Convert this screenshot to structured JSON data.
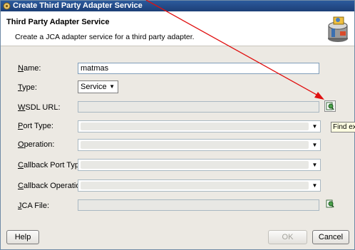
{
  "window": {
    "title": "Create Third Party Adapter Service"
  },
  "banner": {
    "title": "Third Party Adapter Service",
    "description": "Create a JCA adapter service for a third party adapter."
  },
  "form": {
    "name": {
      "label_key": "N",
      "label_rest": "ame:",
      "value": "matmas"
    },
    "type": {
      "label_key": "T",
      "label_rest": "ype:",
      "value": "Service"
    },
    "wsdl_url": {
      "label_key": "W",
      "label_rest": "SDL URL:",
      "value": ""
    },
    "port_type": {
      "label_key": "P",
      "label_rest": "ort Type:",
      "value": ""
    },
    "operation": {
      "label_key": "O",
      "label_rest": "peration:",
      "value": ""
    },
    "callback_port_type": {
      "label_key": "C",
      "label_rest": "allback Port Type:",
      "value": ""
    },
    "callback_operation": {
      "label_key": "C",
      "label_rest": "allback Operation:",
      "value": ""
    },
    "jca_file": {
      "label_key": "J",
      "label_rest": "CA File:",
      "value": ""
    }
  },
  "tooltip": {
    "text": "Find ex"
  },
  "footer": {
    "help_label": "Help",
    "ok_label": "OK",
    "cancel_label": "Cancel"
  },
  "colors": {
    "annotation_arrow": "#e01010",
    "titlebar": "#1d3f77"
  },
  "icons": {
    "titlebar": "app-gear-icon",
    "banner": "adapter-wizard-icon",
    "wsdl_browse": "find-wsdl-icon",
    "jca_browse": "find-jca-icon"
  }
}
